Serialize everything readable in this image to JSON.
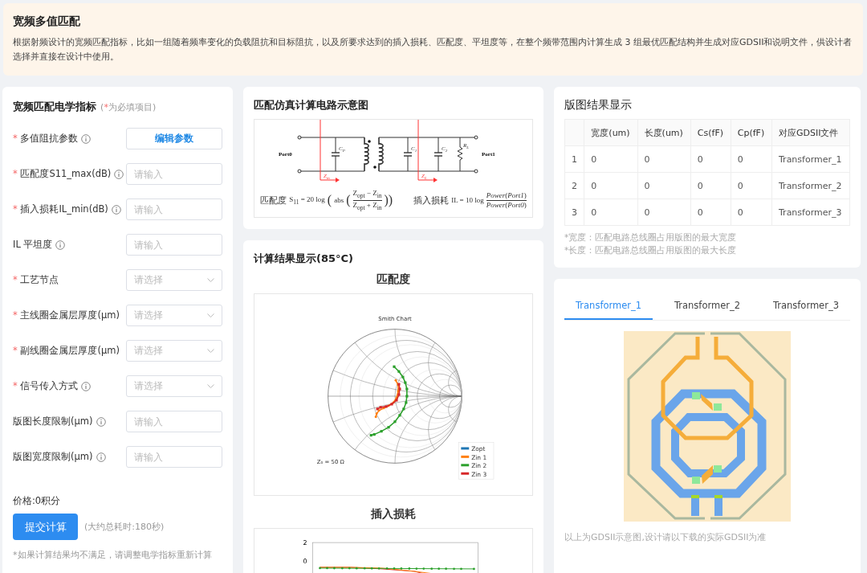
{
  "header": {
    "title": "宽频多值匹配",
    "description": "根据射频设计的宽频匹配指标，比如一组随着频率变化的负载阻抗和目标阻抗，以及所要求达到的插入损耗、匹配度、平坦度等，在整个频带范围内计算生成 3 组最优匹配结构并生成对应GDSII和说明文件，供设计者选择并直接在设计中使用。"
  },
  "form": {
    "title": "宽频匹配电学指标",
    "note_open": "(",
    "note_mark": "*",
    "note_text": "为必填项目)",
    "required_mark": "*",
    "fields": [
      {
        "label": "多值阻抗参数",
        "required": true,
        "info": true,
        "kind": "button",
        "text": "编辑参数"
      },
      {
        "label": "匹配度S11_max(dB)",
        "required": true,
        "info": true,
        "kind": "input",
        "placeholder": "请输入"
      },
      {
        "label": "插入损耗IL_min(dB)",
        "required": true,
        "info": true,
        "kind": "input",
        "placeholder": "请输入"
      },
      {
        "label": "IL 平坦度",
        "required": false,
        "info": true,
        "kind": "input",
        "placeholder": "请输入"
      },
      {
        "label": "工艺节点",
        "required": true,
        "info": false,
        "kind": "select",
        "placeholder": "请选择"
      },
      {
        "label": "主线圈金属层厚度(μm)",
        "required": true,
        "info": false,
        "kind": "select",
        "placeholder": "请选择"
      },
      {
        "label": "副线圈金属层厚度(μm)",
        "required": true,
        "info": false,
        "kind": "select",
        "placeholder": "请选择"
      },
      {
        "label": "信号传入方式",
        "required": true,
        "info": true,
        "kind": "select",
        "placeholder": "请选择"
      },
      {
        "label": "版图长度限制(μm)",
        "required": false,
        "info": true,
        "kind": "input",
        "placeholder": "请输入"
      },
      {
        "label": "版图宽度限制(μm)",
        "required": false,
        "info": true,
        "kind": "input",
        "placeholder": "请输入"
      }
    ],
    "price": "价格:0积分",
    "submit": "提交计算",
    "time_note": "(大约总耗时:180秒)",
    "footnote": "*如果计算结果均不满足，请调整电学指标重新计算"
  },
  "circuit": {
    "title": "匹配仿真计算电路示意图",
    "ports": [
      "Port0",
      "Port1"
    ],
    "labels": [
      {
        "main": "C",
        "sub": "P"
      },
      {
        "main": "C",
        "sub": "1"
      },
      {
        "main": "C",
        "sub": "2"
      },
      {
        "main": "R",
        "sub": "L"
      },
      {
        "main": "Z",
        "sub": "in"
      },
      {
        "main": "Z",
        "sub": "L"
      }
    ],
    "formulas": [
      {
        "name": "匹配度",
        "lhs": "S$_{11}$ = 20 log",
        "pre": [
          "(",
          "abs",
          "("
        ],
        "post": "))",
        "num": "Z$_{opt}$ − Z$_{in}$",
        "den": "Z$_{opt}$ + Z$_{in}$"
      },
      {
        "name": "插入损耗",
        "lhs": "IL = 10 log",
        "num": "*Power*(*Port1*)",
        "den": "*Power*(*Port0*)"
      }
    ]
  },
  "results": {
    "title": "计算结果显示(85°C)",
    "s11_title": "匹配度",
    "smith": {
      "title": "Smith Chart",
      "z0": "Z₀ = 50 Ω",
      "legend": [
        {
          "name": "Zopt",
          "color": "#1f77b4"
        },
        {
          "name": "Zin 1",
          "color": "#ff7f0e"
        },
        {
          "name": "Zin 2",
          "color": "#2ca02c"
        },
        {
          "name": "Zin 3",
          "color": "#d62728"
        }
      ]
    },
    "il_title": "插入损耗",
    "il_ticks": [
      "2",
      "0"
    ]
  },
  "layout_table": {
    "title": "版图结果显示",
    "columns": [
      "",
      "宽度(um)",
      "长度(um)",
      "Cs(fF)",
      "Cp(fF)",
      "对应GDSII文件"
    ],
    "rows": [
      [
        "1",
        "0",
        "0",
        "0",
        "0",
        "Transformer_1"
      ],
      [
        "2",
        "0",
        "0",
        "0",
        "0",
        "Transformer_2"
      ],
      [
        "3",
        "0",
        "0",
        "0",
        "0",
        "Transformer_3"
      ]
    ],
    "notes": [
      "*宽度：匹配电路总线圈占用版图的最大宽度",
      "*长度：匹配电路总线圈占用版图的最大长度"
    ]
  },
  "gds": {
    "tabs": [
      {
        "label": "Transformer_1",
        "selected": true
      },
      {
        "label": "Transformer_2",
        "selected": false
      },
      {
        "label": "Transformer_3",
        "selected": false
      }
    ],
    "caption": "以上为GDSII示意图,设计请以下载的实际GDSII为准"
  }
}
